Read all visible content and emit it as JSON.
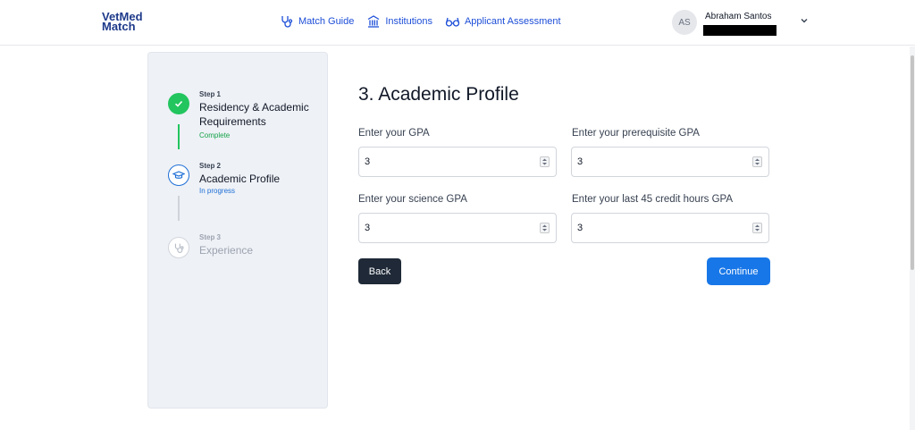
{
  "header": {
    "logo": {
      "line1": "VetMed",
      "line2": "Match"
    },
    "nav": [
      {
        "label": "Match Guide",
        "icon": "stethoscope-icon"
      },
      {
        "label": "Institutions",
        "icon": "institution-icon"
      },
      {
        "label": "Applicant Assessment",
        "icon": "glasses-icon"
      }
    ],
    "user": {
      "initials": "AS",
      "name": "Abraham Santos"
    }
  },
  "stepper": {
    "steps": [
      {
        "number": "Step 1",
        "title": "Residency & Academic Requirements",
        "status": "Complete",
        "state": "complete",
        "icon": "check-icon"
      },
      {
        "number": "Step 2",
        "title": "Academic Profile",
        "status": "In progress",
        "state": "active",
        "icon": "graduation-cap-icon"
      },
      {
        "number": "Step 3",
        "title": "Experience",
        "status": "",
        "state": "pending",
        "icon": "stethoscope-icon"
      }
    ],
    "colors": {
      "complete": "#22c55e",
      "active": "#1d6fd6",
      "pending": "#b6bcc6"
    }
  },
  "main": {
    "title": "3. Academic Profile",
    "fields": {
      "gpa": {
        "label": "Enter your GPA",
        "value": "3"
      },
      "prereq_gpa": {
        "label": "Enter your prerequisite GPA",
        "value": "3"
      },
      "science_gpa": {
        "label": "Enter your science GPA",
        "value": "3"
      },
      "last45_gpa": {
        "label": "Enter your last 45 credit hours GPA",
        "value": "3"
      }
    },
    "back_label": "Back",
    "continue_label": "Continue"
  }
}
